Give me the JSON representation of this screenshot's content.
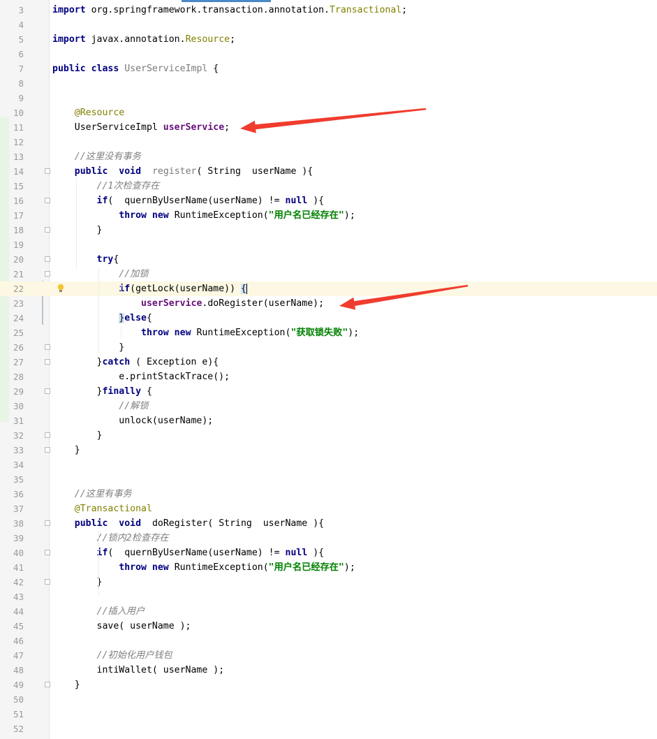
{
  "editor": {
    "current_line": 22,
    "lines": [
      {
        "n": "3",
        "seg": [
          {
            "c": "kw",
            "t": "import"
          },
          {
            "c": "",
            "t": " org.springframework.transaction.annotation."
          },
          {
            "c": "ann",
            "t": "Transactional"
          },
          {
            "c": "",
            "t": ";"
          }
        ]
      },
      {
        "n": "4",
        "seg": []
      },
      {
        "n": "5",
        "seg": [
          {
            "c": "kw",
            "t": "import"
          },
          {
            "c": "",
            "t": " javax.annotation."
          },
          {
            "c": "ann",
            "t": "Resource"
          },
          {
            "c": "",
            "t": ";"
          }
        ]
      },
      {
        "n": "6",
        "seg": []
      },
      {
        "n": "7",
        "seg": [
          {
            "c": "kw",
            "t": "public class"
          },
          {
            "c": "",
            "t": " "
          },
          {
            "c": "cls",
            "t": "UserServiceImpl"
          },
          {
            "c": "",
            "t": " {"
          }
        ]
      },
      {
        "n": "8",
        "seg": []
      },
      {
        "n": "9",
        "seg": []
      },
      {
        "n": "10",
        "seg": [
          {
            "c": "",
            "t": "    "
          },
          {
            "c": "ann",
            "t": "@Resource"
          }
        ]
      },
      {
        "n": "11",
        "seg": [
          {
            "c": "",
            "t": "    UserServiceImpl "
          },
          {
            "c": "fld",
            "t": "userService"
          },
          {
            "c": "",
            "t": ";"
          }
        ]
      },
      {
        "n": "12",
        "seg": []
      },
      {
        "n": "13",
        "seg": [
          {
            "c": "",
            "t": "    "
          },
          {
            "c": "cmt",
            "t": "//这里没有事务"
          }
        ]
      },
      {
        "n": "14",
        "seg": [
          {
            "c": "",
            "t": "    "
          },
          {
            "c": "kw",
            "t": "public"
          },
          {
            "c": "",
            "t": "  "
          },
          {
            "c": "kw",
            "t": "void"
          },
          {
            "c": "",
            "t": "  "
          },
          {
            "c": "cls",
            "t": "register"
          },
          {
            "c": "",
            "t": "( String  userName ){"
          }
        ]
      },
      {
        "n": "15",
        "seg": [
          {
            "c": "",
            "t": "        "
          },
          {
            "c": "cmt",
            "t": "//1次检查存在"
          }
        ]
      },
      {
        "n": "16",
        "seg": [
          {
            "c": "",
            "t": "        "
          },
          {
            "c": "kw",
            "t": "if"
          },
          {
            "c": "",
            "t": "(  quernByUserName(userName) != "
          },
          {
            "c": "kw",
            "t": "null"
          },
          {
            "c": "",
            "t": " ){"
          }
        ]
      },
      {
        "n": "17",
        "seg": [
          {
            "c": "",
            "t": "            "
          },
          {
            "c": "kw",
            "t": "throw new"
          },
          {
            "c": "",
            "t": " RuntimeException("
          },
          {
            "c": "str",
            "t": "\"用户名已经存在\""
          },
          {
            "c": "",
            "t": ");"
          }
        ]
      },
      {
        "n": "18",
        "seg": [
          {
            "c": "",
            "t": "        }"
          }
        ]
      },
      {
        "n": "19",
        "seg": []
      },
      {
        "n": "20",
        "seg": [
          {
            "c": "",
            "t": "        "
          },
          {
            "c": "kw",
            "t": "try"
          },
          {
            "c": "",
            "t": "{"
          }
        ]
      },
      {
        "n": "21",
        "seg": [
          {
            "c": "",
            "t": "            "
          },
          {
            "c": "cmt",
            "t": "//加锁"
          }
        ]
      },
      {
        "n": "22",
        "seg": [
          {
            "c": "",
            "t": "            "
          },
          {
            "c": "kw",
            "t": "if"
          },
          {
            "c": "",
            "t": "(getLock(userName)) "
          },
          {
            "c": "brace-hl",
            "t": "{"
          }
        ]
      },
      {
        "n": "23",
        "seg": [
          {
            "c": "",
            "t": "                "
          },
          {
            "c": "fld",
            "t": "userService"
          },
          {
            "c": "",
            "t": ".doRegister(userName);"
          }
        ]
      },
      {
        "n": "24",
        "seg": [
          {
            "c": "",
            "t": "            "
          },
          {
            "c": "brace-hl",
            "t": "}"
          },
          {
            "c": "kw",
            "t": "else"
          },
          {
            "c": "",
            "t": "{"
          }
        ]
      },
      {
        "n": "25",
        "seg": [
          {
            "c": "",
            "t": "                "
          },
          {
            "c": "kw",
            "t": "throw new"
          },
          {
            "c": "",
            "t": " RuntimeException("
          },
          {
            "c": "str",
            "t": "\"获取锁失败\""
          },
          {
            "c": "",
            "t": ");"
          }
        ]
      },
      {
        "n": "26",
        "seg": [
          {
            "c": "",
            "t": "            }"
          }
        ]
      },
      {
        "n": "27",
        "seg": [
          {
            "c": "",
            "t": "        }"
          },
          {
            "c": "kw",
            "t": "catch"
          },
          {
            "c": "",
            "t": " ( Exception e){"
          }
        ]
      },
      {
        "n": "28",
        "seg": [
          {
            "c": "",
            "t": "            e.printStackTrace();"
          }
        ]
      },
      {
        "n": "29",
        "seg": [
          {
            "c": "",
            "t": "        }"
          },
          {
            "c": "kw",
            "t": "finally"
          },
          {
            "c": "",
            "t": " {"
          }
        ]
      },
      {
        "n": "30",
        "seg": [
          {
            "c": "",
            "t": "            "
          },
          {
            "c": "cmt",
            "t": "//解锁"
          }
        ]
      },
      {
        "n": "31",
        "seg": [
          {
            "c": "",
            "t": "            unlock(userName);"
          }
        ]
      },
      {
        "n": "32",
        "seg": [
          {
            "c": "",
            "t": "        }"
          }
        ]
      },
      {
        "n": "33",
        "seg": [
          {
            "c": "",
            "t": "    }"
          }
        ]
      },
      {
        "n": "34",
        "seg": []
      },
      {
        "n": "35",
        "seg": []
      },
      {
        "n": "36",
        "seg": [
          {
            "c": "",
            "t": "    "
          },
          {
            "c": "cmt",
            "t": "//这里有事务"
          }
        ]
      },
      {
        "n": "37",
        "seg": [
          {
            "c": "",
            "t": "    "
          },
          {
            "c": "ann",
            "t": "@Transactional"
          }
        ]
      },
      {
        "n": "38",
        "seg": [
          {
            "c": "",
            "t": "    "
          },
          {
            "c": "kw",
            "t": "public"
          },
          {
            "c": "",
            "t": "  "
          },
          {
            "c": "kw",
            "t": "void"
          },
          {
            "c": "",
            "t": "  doRegister( String  userName ){"
          }
        ]
      },
      {
        "n": "39",
        "seg": [
          {
            "c": "",
            "t": "        "
          },
          {
            "c": "cmt",
            "t": "//锁内2检查存在"
          }
        ]
      },
      {
        "n": "40",
        "seg": [
          {
            "c": "",
            "t": "        "
          },
          {
            "c": "kw",
            "t": "if"
          },
          {
            "c": "",
            "t": "(  quernByUserName(userName) != "
          },
          {
            "c": "kw",
            "t": "null"
          },
          {
            "c": "",
            "t": " ){"
          }
        ]
      },
      {
        "n": "41",
        "seg": [
          {
            "c": "",
            "t": "            "
          },
          {
            "c": "kw",
            "t": "throw new"
          },
          {
            "c": "",
            "t": " RuntimeException("
          },
          {
            "c": "str",
            "t": "\"用户名已经存在\""
          },
          {
            "c": "",
            "t": ");"
          }
        ]
      },
      {
        "n": "42",
        "seg": [
          {
            "c": "",
            "t": "        }"
          }
        ]
      },
      {
        "n": "43",
        "seg": []
      },
      {
        "n": "44",
        "seg": [
          {
            "c": "",
            "t": "        "
          },
          {
            "c": "cmt",
            "t": "//插入用户"
          }
        ]
      },
      {
        "n": "45",
        "seg": [
          {
            "c": "",
            "t": "        save( userName );"
          }
        ]
      },
      {
        "n": "46",
        "seg": []
      },
      {
        "n": "47",
        "seg": [
          {
            "c": "",
            "t": "        "
          },
          {
            "c": "cmt",
            "t": "//初始化用户钱包"
          }
        ]
      },
      {
        "n": "48",
        "seg": [
          {
            "c": "",
            "t": "        intiWallet( userName );"
          }
        ]
      },
      {
        "n": "49",
        "seg": [
          {
            "c": "",
            "t": "    }"
          }
        ]
      },
      {
        "n": "50",
        "seg": []
      },
      {
        "n": "51",
        "seg": []
      },
      {
        "n": "52",
        "seg": []
      }
    ],
    "fold_lines": [
      "14",
      "16",
      "18",
      "20",
      "21",
      "26",
      "27",
      "29",
      "32",
      "33",
      "38",
      "40",
      "42",
      "49"
    ],
    "annotations": {
      "arrow_color": "#f03c2e"
    }
  }
}
